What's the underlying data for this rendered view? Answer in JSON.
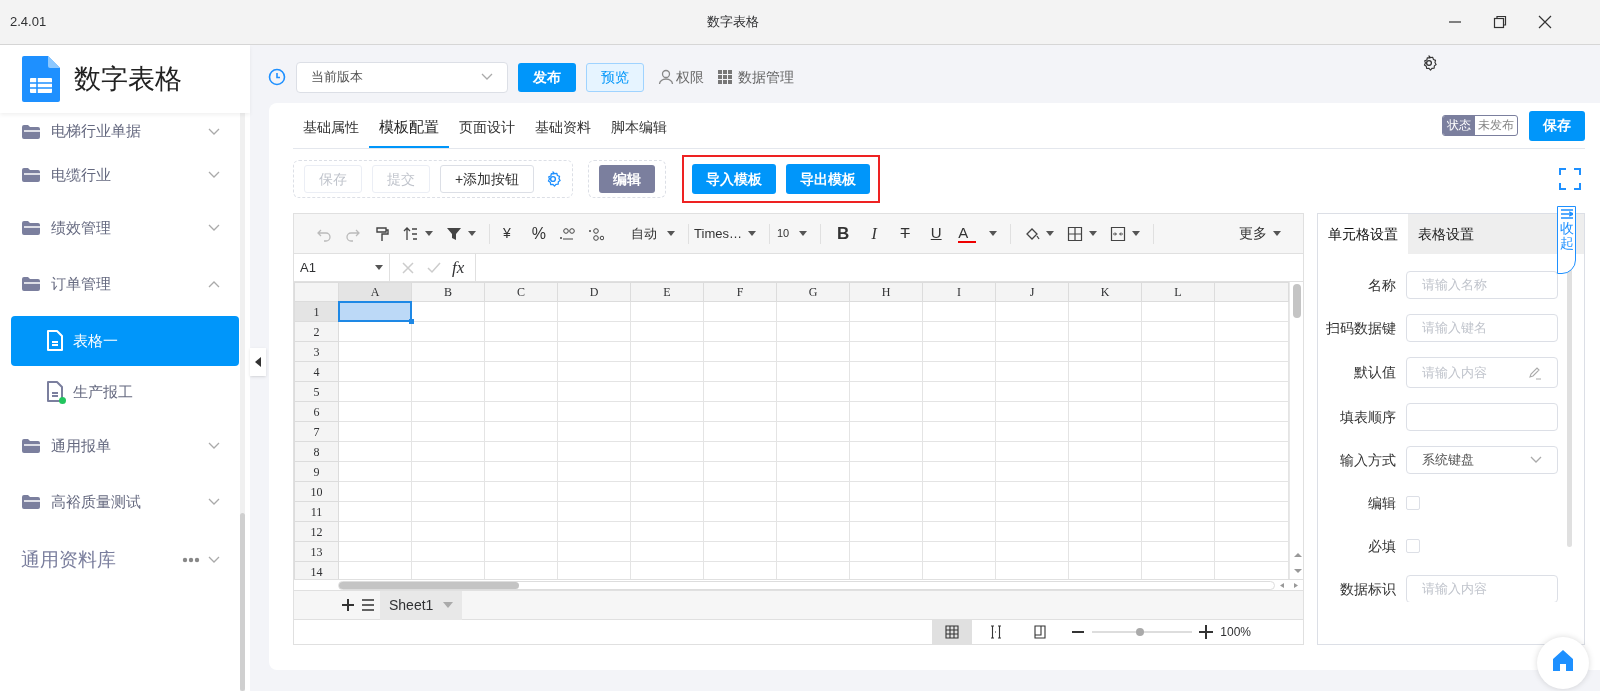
{
  "window": {
    "version": "2.4.01",
    "title": "数字表格"
  },
  "sidebar": {
    "app_name": "数字表格",
    "items": [
      {
        "label": "电梯行业单据",
        "expanded": false
      },
      {
        "label": "电缆行业",
        "expanded": false
      },
      {
        "label": "绩效管理",
        "expanded": false
      },
      {
        "label": "订单管理",
        "expanded": true,
        "children": [
          {
            "label": "表格一",
            "selected": true,
            "status_dot": false
          },
          {
            "label": "生产报工",
            "selected": false,
            "status_dot": true
          }
        ]
      },
      {
        "label": "通用报单",
        "expanded": false
      },
      {
        "label": "高裕质量测试",
        "expanded": false
      }
    ],
    "library": {
      "label": "通用资料库",
      "expanded": false
    }
  },
  "top_bar": {
    "version_select": {
      "value": "当前版本"
    },
    "publish_button": "发布",
    "preview_button": "预览",
    "links": [
      "权限",
      "数据管理"
    ]
  },
  "editor": {
    "tabs": [
      {
        "label": "基础属性",
        "selected": false
      },
      {
        "label": "模板配置",
        "selected": true
      },
      {
        "label": "页面设计",
        "selected": false
      },
      {
        "label": "基础资料",
        "selected": false
      },
      {
        "label": "脚本编辑",
        "selected": false
      }
    ],
    "status": {
      "label": "状态",
      "value": "未发布"
    },
    "save_button": "保存",
    "actions": [
      {
        "label": "保存",
        "disabled": true
      },
      {
        "label": "提交",
        "disabled": true
      },
      {
        "label": "+添加按钮",
        "disabled": false
      }
    ],
    "edit_button": "编辑",
    "template_buttons": [
      "导入模板",
      "导出模板"
    ]
  },
  "spreadsheet": {
    "toolbar": {
      "currency": "¥",
      "percent": "%",
      "number_format": "自动",
      "font": "Times…",
      "font_size": "10",
      "styles": [
        "B",
        "I",
        "T",
        "U",
        "A"
      ],
      "more": "更多"
    },
    "cell_ref": "A1",
    "formula_label": "fx",
    "columns": [
      {
        "label": "A",
        "selected": true
      },
      {
        "label": "B",
        "selected": false
      },
      {
        "label": "C",
        "selected": false
      },
      {
        "label": "D",
        "selected": false
      },
      {
        "label": "E",
        "selected": false
      },
      {
        "label": "F",
        "selected": false
      },
      {
        "label": "G",
        "selected": false
      },
      {
        "label": "H",
        "selected": false
      },
      {
        "label": "I",
        "selected": false
      },
      {
        "label": "J",
        "selected": false
      },
      {
        "label": "K",
        "selected": false
      },
      {
        "label": "L",
        "selected": false
      }
    ],
    "rows": [
      {
        "label": "1",
        "selected": true
      },
      {
        "label": "2",
        "selected": false
      },
      {
        "label": "3",
        "selected": false
      },
      {
        "label": "4",
        "selected": false
      },
      {
        "label": "5",
        "selected": false
      },
      {
        "label": "6",
        "selected": false
      },
      {
        "label": "7",
        "selected": false
      },
      {
        "label": "8",
        "selected": false
      },
      {
        "label": "9",
        "selected": false
      },
      {
        "label": "10",
        "selected": false
      },
      {
        "label": "11",
        "selected": false
      },
      {
        "label": "12",
        "selected": false
      },
      {
        "label": "13",
        "selected": false
      },
      {
        "label": "14",
        "selected": false
      }
    ],
    "sheets": [
      {
        "name": "Sheet1",
        "selected": true
      }
    ],
    "views": [
      {
        "kind": "normal",
        "selected": true
      },
      {
        "kind": "page_break",
        "selected": false
      },
      {
        "kind": "page_layout",
        "selected": false
      }
    ],
    "zoom": {
      "level": 0.48,
      "reading": "100%"
    }
  },
  "settings_panel": {
    "tabs": [
      {
        "label": "单元格设置",
        "selected": true
      },
      {
        "label": "表格设置",
        "selected": false
      }
    ],
    "fields": [
      {
        "kind": "text",
        "label": "名称",
        "placeholder": "请输入名称"
      },
      {
        "kind": "text",
        "label": "扫码数据键",
        "placeholder": "请输入键名"
      },
      {
        "kind": "text_edit",
        "label": "默认值",
        "placeholder": "请输入内容"
      },
      {
        "kind": "text",
        "label": "填表顺序"
      },
      {
        "kind": "select",
        "label": "输入方式",
        "value": "系统键盘"
      },
      {
        "kind": "checkbox",
        "label": "编辑",
        "checked": false
      },
      {
        "kind": "checkbox",
        "label": "必填",
        "checked": false
      },
      {
        "kind": "text",
        "label": "数据标识",
        "placeholder": "请输入内容"
      }
    ],
    "collapse_tab": "收起"
  }
}
